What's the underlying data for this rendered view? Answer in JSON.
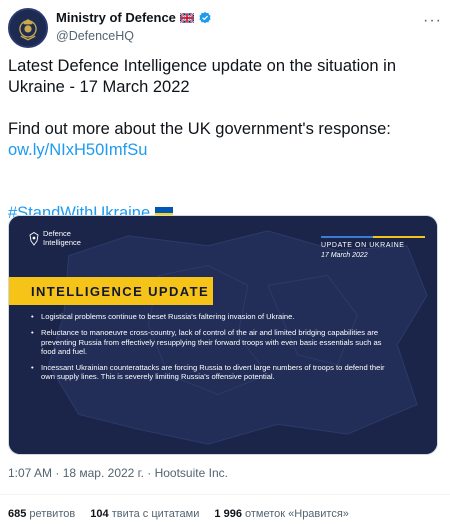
{
  "account": {
    "name": "Ministry of Defence",
    "handle": "@DefenceHQ",
    "more_icon": "more-horizontal-icon"
  },
  "tweet": {
    "line1": "Latest Defence Intelligence update on the situation in Ukraine - 17 March 2022",
    "line2": "Find out more about the UK government's response:",
    "link": "ow.ly/NIxH50ImfSu",
    "hashtag": "#StandWithUkraine"
  },
  "card": {
    "logo_line1": "Defence",
    "logo_line2": "Intelligence",
    "update_title": "UPDATE ON UKRAINE",
    "update_date": "17 March 2022",
    "banner": "INTELLIGENCE UPDATE",
    "bullets": [
      "Logistical problems continue to beset Russia's faltering invasion of Ukraine.",
      "Reluctance to manoeuvre cross-country, lack of control of the air and limited bridging capabilities are preventing Russia from effectively resupplying their forward troops with even basic essentials such as food and fuel.",
      "Incessant Ukrainian counterattacks are forcing Russia to divert large numbers of troops to defend their own supply lines. This is severely limiting Russia's offensive potential."
    ]
  },
  "meta": {
    "timestamp": "1:07 AM · 18 мар. 2022 г. · Hootsuite Inc."
  },
  "stats": {
    "retweets_count": "685",
    "retweets_label": "ретвитов",
    "quotes_count": "104",
    "quotes_label": "твита с цитатами",
    "likes_count": "1 996",
    "likes_label": "отметок «Нравится»"
  },
  "colors": {
    "link": "#1d9bf0",
    "card_bg": "#1b2549",
    "banner": "#f6c318",
    "ukraine_blue": "#0057b7",
    "ukraine_yellow": "#ffd700"
  }
}
